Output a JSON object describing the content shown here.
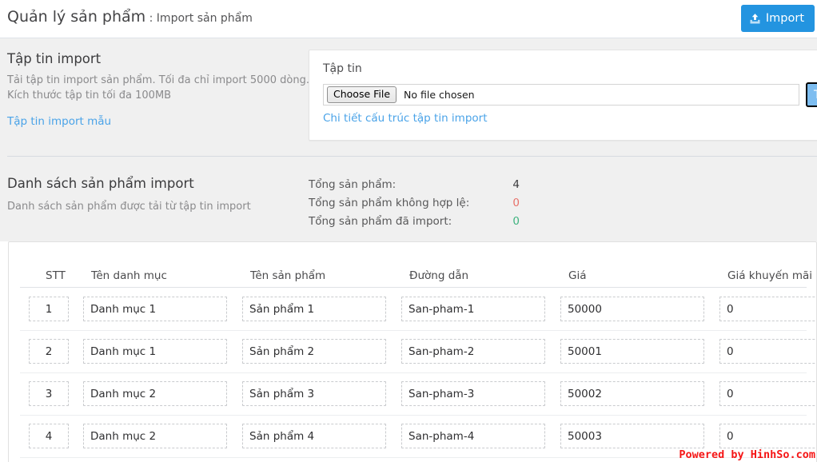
{
  "header": {
    "title_main": "Quản lý sản phẩm",
    "title_sep": " : ",
    "title_sub": "Import sản phẩm",
    "import_button_label": "Import",
    "import_icon": "upload-icon",
    "accent_color": "#2394e0"
  },
  "import_section": {
    "title": "Tập tin import",
    "desc_line1": "Tải tập tin import sản phẩm. Tối đa chỉ import 5000 dòng.",
    "desc_line2": "Kích thước tập tin tối đa 100MB",
    "sample_link": "Tập tin import mẫu"
  },
  "file_card": {
    "label": "Tập tin",
    "choose_file_label": "Choose File",
    "no_file_text": "No file chosen",
    "structure_link": "Chi tiết cấu trúc tập tin import",
    "upload_button_label": "Tải lên"
  },
  "list_section": {
    "title": "Danh sách sản phẩm import",
    "desc": "Danh sách sản phẩm được tải từ tập tin import"
  },
  "stats": [
    {
      "label": "Tổng sản phẩm:",
      "value": "4",
      "tone": "neutral",
      "color": "#3b3b3d"
    },
    {
      "label": "Tổng sản phẩm không hợp lệ:",
      "value": "0",
      "tone": "danger",
      "color": "#e8716a"
    },
    {
      "label": "Tổng sản phẩm đã import:",
      "value": "0",
      "tone": "success",
      "color": "#3fb37f"
    }
  ],
  "table": {
    "columns": [
      {
        "key": "stt",
        "label": "STT"
      },
      {
        "key": "cat",
        "label": "Tên danh mục"
      },
      {
        "key": "name",
        "label": "Tên sản phẩm"
      },
      {
        "key": "path",
        "label": "Đường dẫn"
      },
      {
        "key": "price",
        "label": "Giá"
      },
      {
        "key": "promo",
        "label": "Giá khuyến mãi"
      }
    ],
    "rows": [
      {
        "stt": "1",
        "cat": "Danh mục 1",
        "name": "Sản phẩm 1",
        "path": "San-pham-1",
        "price": "50000",
        "promo": "0"
      },
      {
        "stt": "2",
        "cat": "Danh mục 1",
        "name": "Sản phẩm 2",
        "path": "San-pham-2",
        "price": "50001",
        "promo": "0"
      },
      {
        "stt": "3",
        "cat": "Danh mục 2",
        "name": "Sản phẩm 3",
        "path": "San-pham-3",
        "price": "50002",
        "promo": "0"
      },
      {
        "stt": "4",
        "cat": "Danh mục 2",
        "name": "Sản phẩm 4",
        "path": "San-pham-4",
        "price": "50003",
        "promo": "0"
      }
    ]
  },
  "watermark": {
    "text": "Powered by HinhSo.com",
    "color": "#f51616"
  }
}
